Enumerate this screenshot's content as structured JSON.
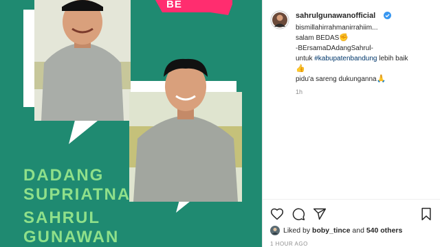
{
  "post_image": {
    "badge_label": "BE",
    "names": [
      "DADANG",
      "SUPRIATNA",
      "SAHRUL",
      "GUNAWAN"
    ],
    "colors": {
      "background": "#1f8a71",
      "name_text": "#8fe08a",
      "badge": "#ff2d6f"
    }
  },
  "post": {
    "username": "sahrulgunawanofficial",
    "verified_icon": "verified-badge-icon",
    "caption": {
      "line1": "bismillahirrahmanirrahiim...",
      "line2": "salam BEDAS",
      "line2_emoji": "✊",
      "line3": "-BErsamaDAdangSahrul-",
      "line4_prefix": "untuk ",
      "line4_hashtag": "#kabupatenbandung",
      "line4_suffix": " lebih baik",
      "line5_emoji": "👍",
      "line6": "pidu'a sareng dukunganna",
      "line6_emoji": "🙏"
    },
    "time_ago": "1h",
    "likes": {
      "prefix": "Liked by ",
      "user": "boby_tince",
      "middle": " and ",
      "others": "540 others"
    },
    "date": "1 HOUR AGO"
  },
  "actions": {
    "like": "heart-icon",
    "comment": "comment-icon",
    "share": "share-icon",
    "save": "bookmark-icon"
  }
}
